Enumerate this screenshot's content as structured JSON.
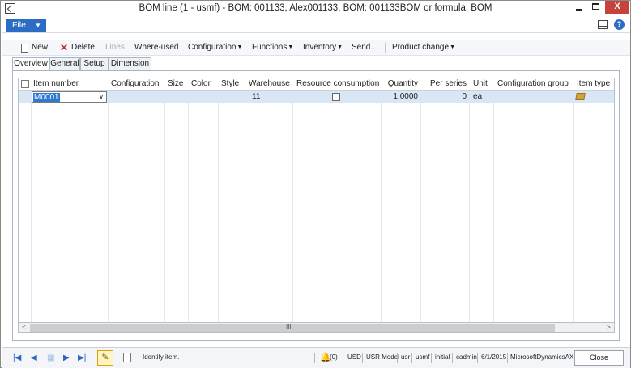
{
  "window": {
    "title": "BOM line (1 - usmf) - BOM: 001133, Alex001133, BOM: 001133BOM or formula: BOM",
    "close_glyph": "X"
  },
  "filebar": {
    "file_label": "File"
  },
  "actions": {
    "new": "New",
    "delete": "Delete",
    "lines": "Lines",
    "where_used": "Where-used",
    "configuration": "Configuration",
    "functions": "Functions",
    "inventory": "Inventory",
    "send": "Send...",
    "product_change": "Product change"
  },
  "tabs": [
    "Overview",
    "General",
    "Setup",
    "Dimension"
  ],
  "grid": {
    "columns": [
      "Item number",
      "Configuration",
      "Size",
      "Color",
      "Style",
      "Warehouse",
      "Resource consumption",
      "Quantity",
      "Per series",
      "Unit",
      "Configuration group",
      "Item type"
    ],
    "rows": [
      {
        "item_number": "M0001",
        "configuration": "",
        "size": "",
        "color": "",
        "style": "",
        "warehouse": "11",
        "resource_consumption": false,
        "quantity": "1.0000",
        "per_series": "0",
        "unit": "ea",
        "configuration_group": "",
        "item_type": "item-icon"
      }
    ]
  },
  "status": {
    "help_text": "Identify item.",
    "notifications": "(0)",
    "currency": "USD",
    "model": "USR Model",
    "layer": "usr",
    "company": "usmf",
    "initial": "initial",
    "user": "cadmin",
    "date": "6/1/2015",
    "application": "MicrosoftDynamicsAX",
    "close_label": "Close"
  }
}
